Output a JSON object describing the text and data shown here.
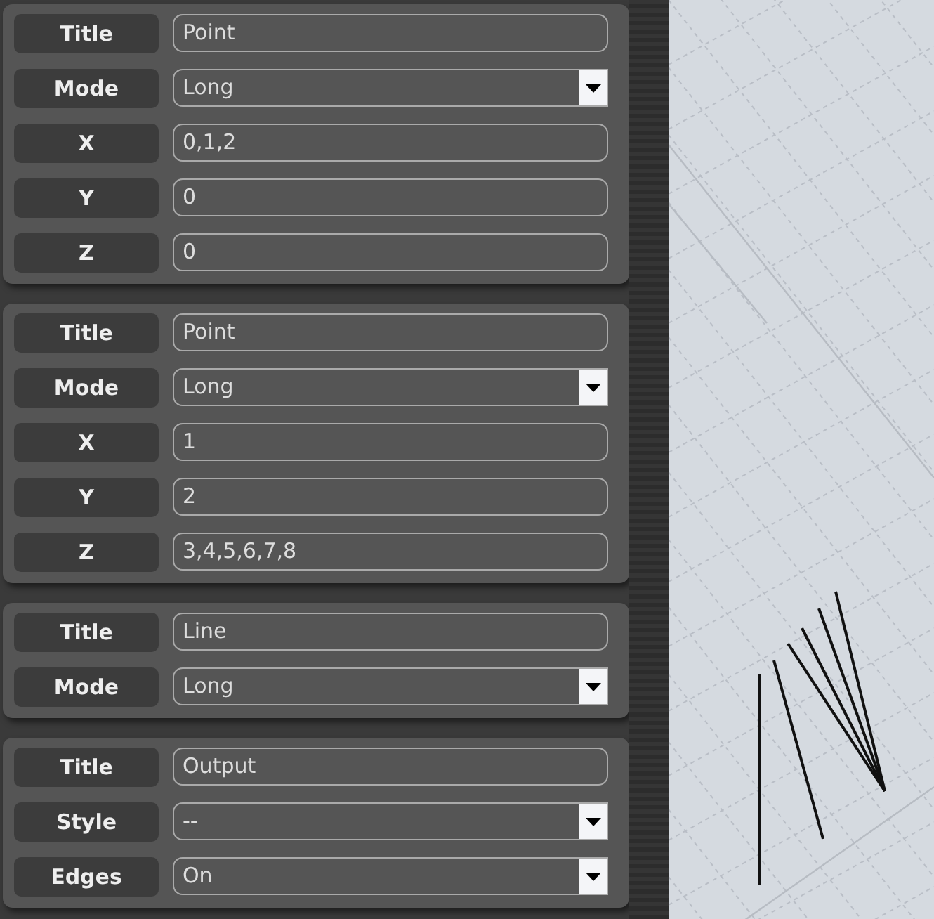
{
  "panels": [
    {
      "rows": [
        {
          "label": "Title",
          "kind": "text",
          "value": "Point"
        },
        {
          "label": "Mode",
          "kind": "select",
          "value": "Long"
        },
        {
          "label": "X",
          "kind": "text",
          "value": "0,1,2"
        },
        {
          "label": "Y",
          "kind": "text",
          "value": "0"
        },
        {
          "label": "Z",
          "kind": "text",
          "value": "0"
        }
      ]
    },
    {
      "rows": [
        {
          "label": "Title",
          "kind": "text",
          "value": "Point"
        },
        {
          "label": "Mode",
          "kind": "select",
          "value": "Long"
        },
        {
          "label": "X",
          "kind": "text",
          "value": "1"
        },
        {
          "label": "Y",
          "kind": "text",
          "value": "2"
        },
        {
          "label": "Z",
          "kind": "text",
          "value": "3,4,5,6,7,8"
        }
      ]
    },
    {
      "rows": [
        {
          "label": "Title",
          "kind": "text",
          "value": "Line"
        },
        {
          "label": "Mode",
          "kind": "select",
          "value": "Long"
        }
      ]
    },
    {
      "rows": [
        {
          "label": "Title",
          "kind": "text",
          "value": "Output"
        },
        {
          "label": "Style",
          "kind": "select",
          "value": "--"
        },
        {
          "label": "Edges",
          "kind": "select",
          "value": "On"
        }
      ]
    }
  ]
}
